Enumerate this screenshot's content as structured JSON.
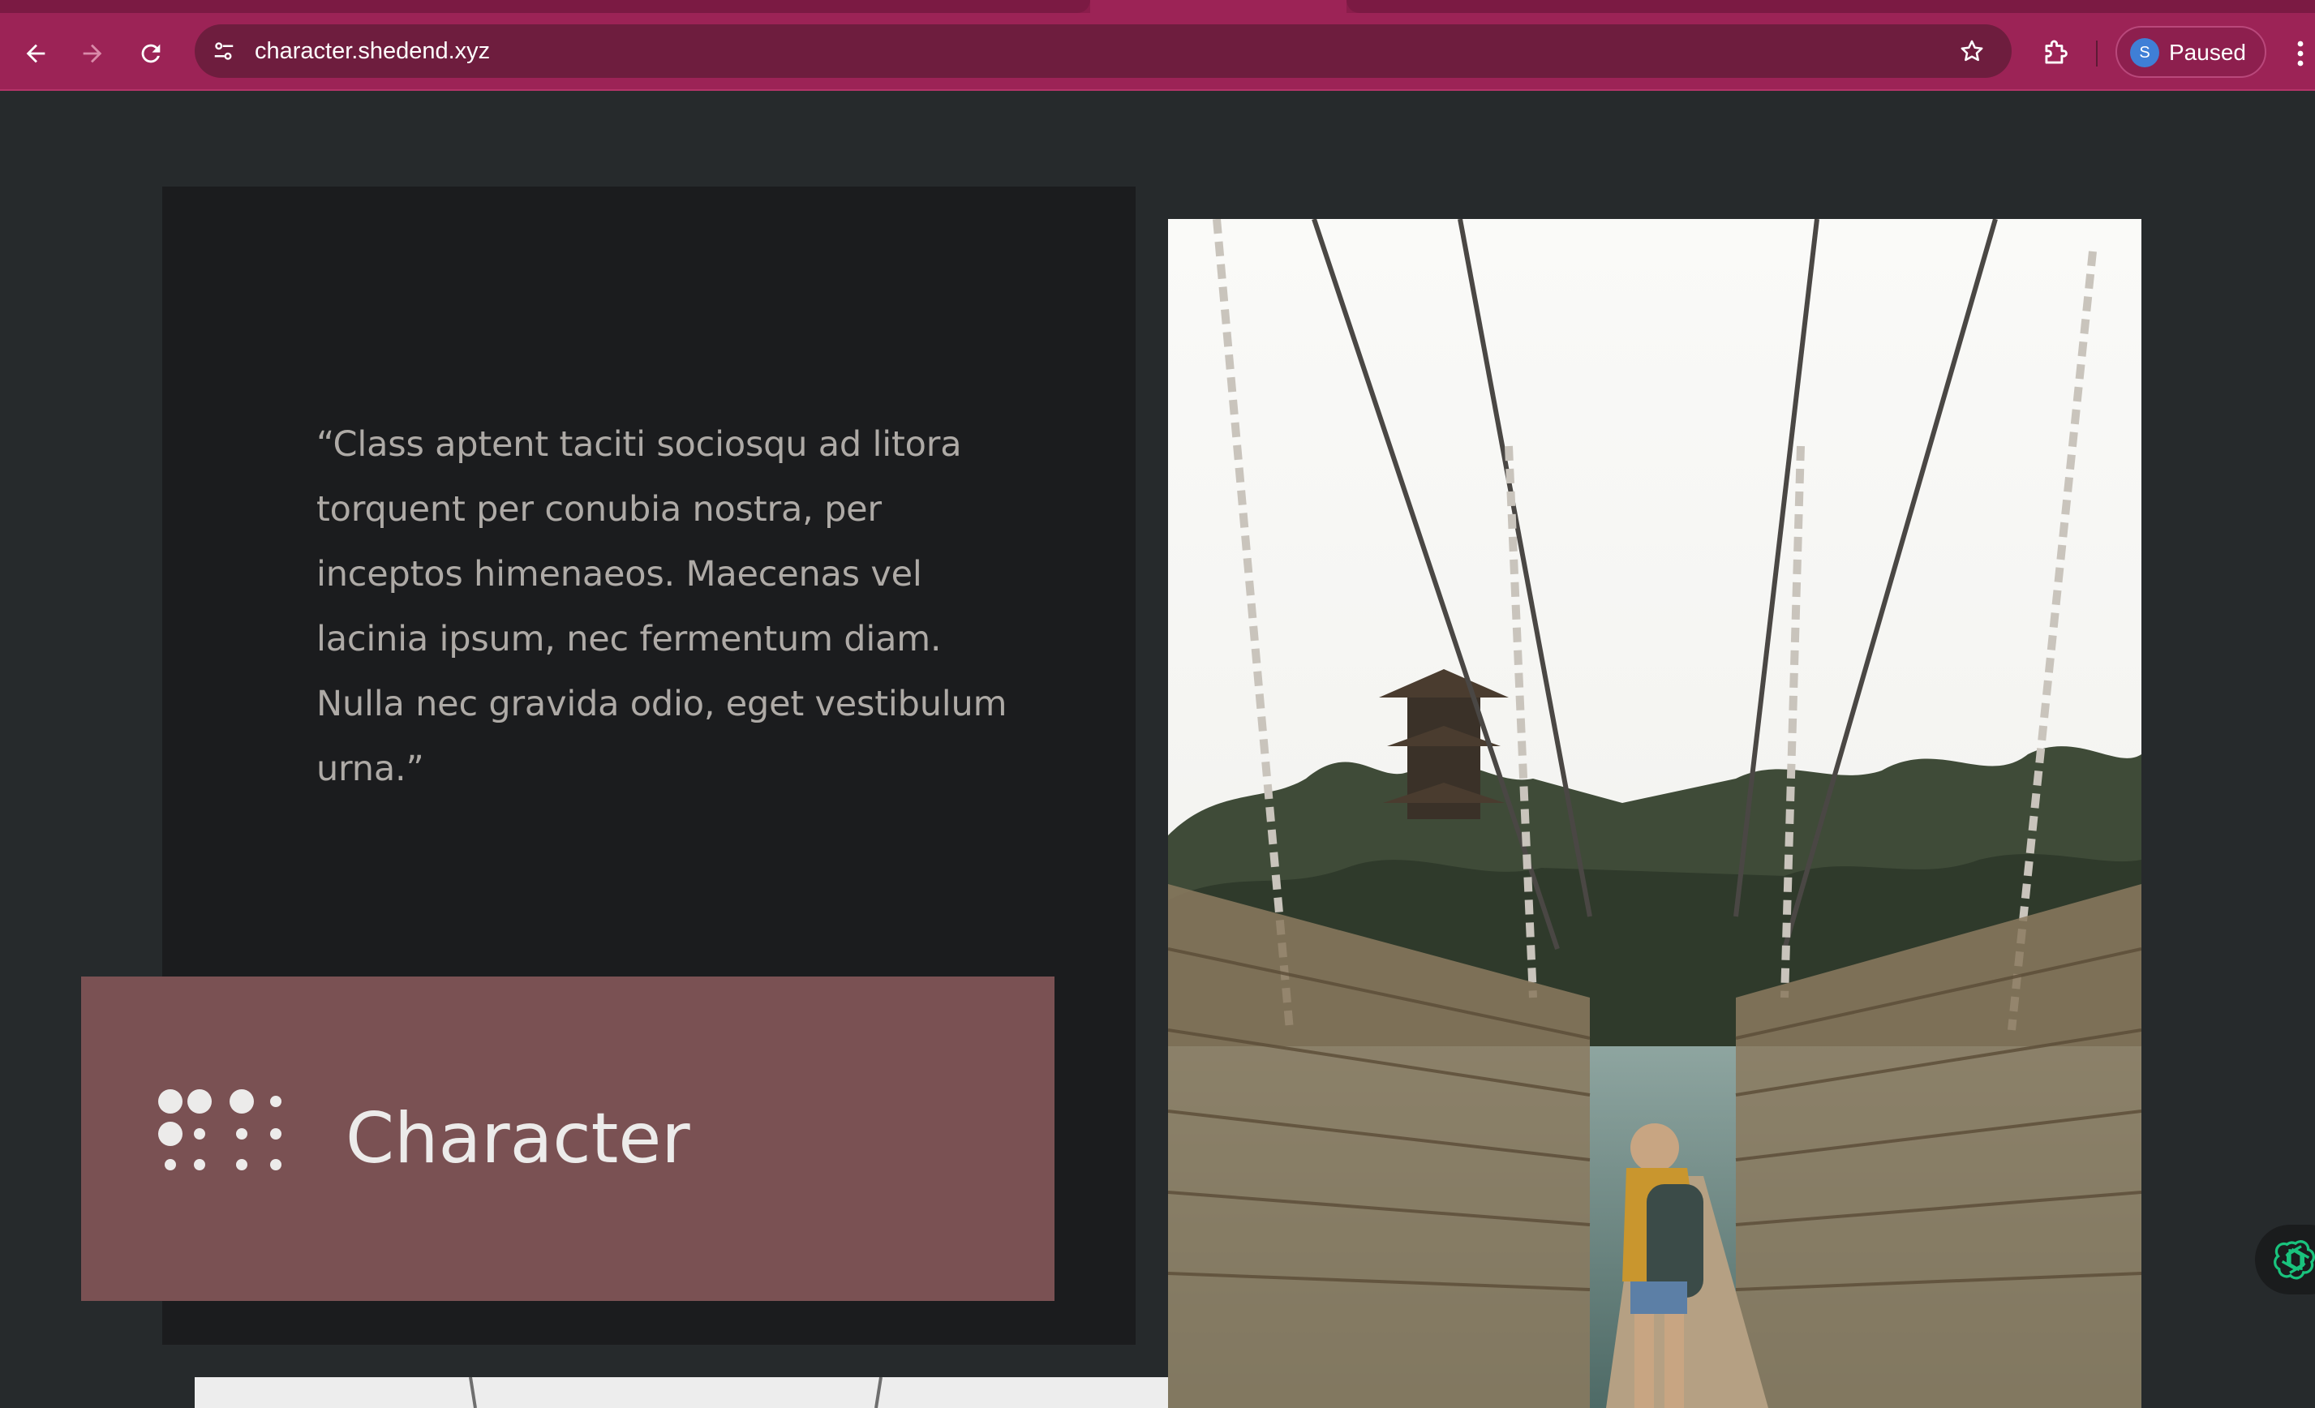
{
  "browser": {
    "url": "character.shedend.xyz",
    "profile_initial": "S",
    "profile_status": "Paused",
    "icons": {
      "back": "arrow-left-icon",
      "forward": "arrow-right-icon",
      "reload": "reload-icon",
      "site_info": "tune-icon",
      "bookmark": "star-icon",
      "extensions": "puzzle-icon",
      "menu": "kebab-menu-icon"
    }
  },
  "page": {
    "quote": "“Class aptent taciti sociosqu ad litora torquent per conubia nostra, per inceptos himenaeos. Maecenas vel lacinia ipsum, nec fermentum diam. Nulla nec gravida odio, eget vestibulum urna.”",
    "feature_title": "Character",
    "feature_icon": "braille-dots-icon",
    "photo_subject": "woman-on-rope-bridge-photo",
    "assistant_icon": "openai-logo-icon"
  },
  "colors": {
    "chrome_bg": "#9c2356",
    "omnibox_bg": "#6e1d3e",
    "page_bg": "#262a2c",
    "card_bg": "#1b1c1e",
    "label_bg": "#7a5153",
    "quote_text": "#aeaaa6"
  }
}
